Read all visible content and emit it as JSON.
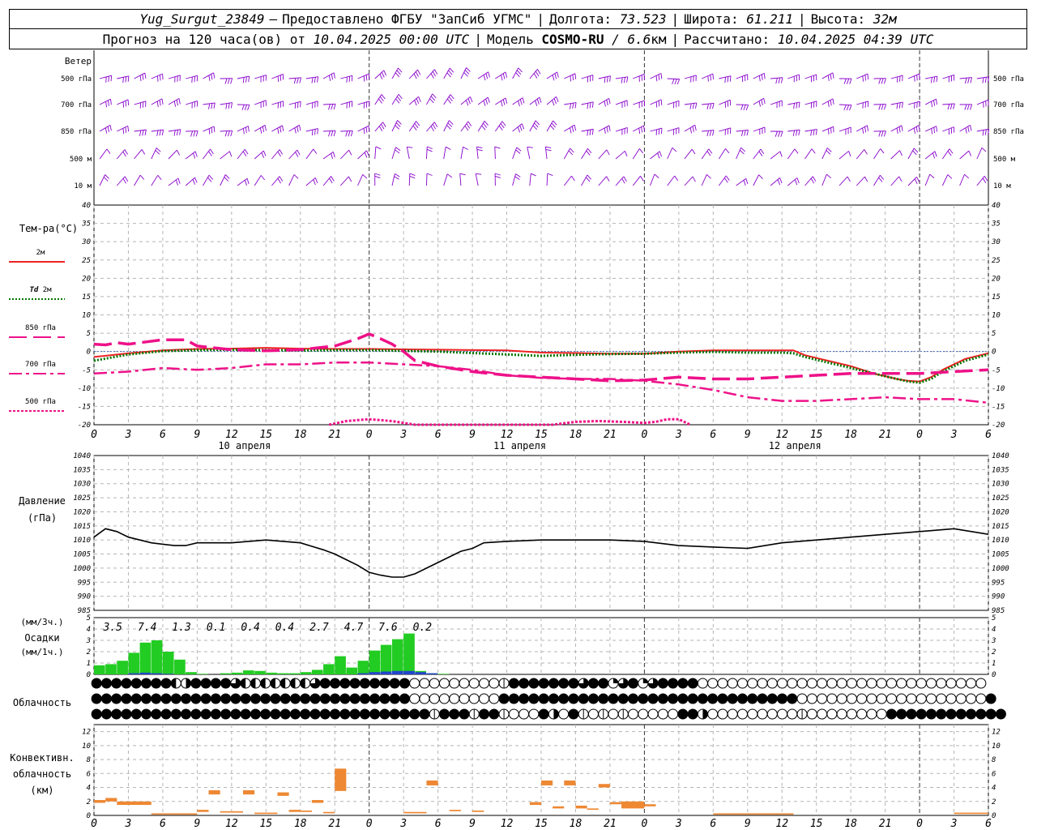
{
  "header": {
    "station": "Yug_Surgut_23849",
    "dash": "—",
    "provider": "Предоставлено ФГБУ \"ЗапСиб УГМС\"",
    "lon_label": "Долгота:",
    "lon_value": "73.523",
    "lat_label": "Широта:",
    "lat_value": "61.211",
    "alt_label": "Высота:",
    "alt_value": "32м",
    "forecast_prefix": "Прогноз на 120 часа(ов) от",
    "forecast_time": "10.04.2025 00:00 UTC",
    "model_label": "Модель",
    "model_name": "COSMO-RU",
    "model_res": "/ 6.6",
    "model_res_unit": "км",
    "calc_label": "Рассчитано:",
    "calc_time": "10.04.2025 04:39 UTC"
  },
  "labels": {
    "wind": "Ветер",
    "temp": "Тем-ра(°С)",
    "pressure1": "Давление",
    "pressure2": "(гПа)",
    "precip1": "(мм/3ч.)",
    "precip2": "Осадки",
    "precip3": "(мм/1ч.)",
    "cloud": "Облачность",
    "conv1": "Конвективн.",
    "conv2": "облачность",
    "conv3": "(км)"
  },
  "colors": {
    "t2m": "#ee2222",
    "td2m": "#007700",
    "t850": "#ee1188",
    "t700": "#ee1188",
    "t500": "#ee1188",
    "wind": "#8800cc",
    "precip3h": "#22cc22",
    "precip1h": "#2244cc",
    "convective": "#ee8833",
    "pressure": "#000000"
  },
  "chart_data": [
    {
      "type": "wind_barbs",
      "levels": [
        "500 гПа",
        "700 гПа",
        "850 гПа",
        "500 м",
        "10  м"
      ],
      "hours": [
        0,
        120
      ],
      "title": "Ветер"
    },
    {
      "type": "line",
      "title": "Тем-ра(°С)",
      "ylim": [
        -20,
        40
      ],
      "yticks": [
        40,
        35,
        30,
        25,
        20,
        15,
        10,
        5,
        0,
        -5,
        -10,
        -15,
        -20
      ],
      "x_hours": [
        0,
        3,
        6,
        9,
        12,
        15,
        18,
        21,
        24,
        27,
        30,
        33,
        36,
        39,
        42,
        45,
        48,
        51,
        54,
        57,
        60,
        63,
        66,
        69,
        72,
        75,
        78
      ],
      "x_tick_labels": [
        "0",
        "3",
        "6",
        "9",
        "12",
        "15",
        "18",
        "21",
        "0",
        "3",
        "6",
        "9",
        "12",
        "15",
        "18",
        "21",
        "0",
        "3",
        "6",
        "9",
        "12",
        "15",
        "18",
        "21",
        "0",
        "3",
        "6"
      ],
      "day_labels": [
        {
          "hour": 12,
          "text": "10 апреля"
        },
        {
          "hour": 36,
          "text": "11 апреля"
        },
        {
          "hour": 60,
          "text": "12 апреля"
        }
      ],
      "series": [
        {
          "name": "2м",
          "key": "t2m",
          "style": "solid",
          "x": [
            0,
            3,
            6,
            9,
            12,
            15,
            18,
            21,
            24,
            27,
            30,
            33,
            36,
            39,
            42,
            45,
            48,
            51,
            54,
            57,
            60,
            61,
            62,
            64,
            66,
            68,
            70,
            71,
            72,
            73,
            74,
            76,
            78
          ],
          "y": [
            -1.5,
            -0.5,
            0.3,
            0.7,
            0.8,
            1.0,
            0.8,
            0.7,
            0.7,
            0.6,
            0.5,
            0.4,
            0.3,
            -0.3,
            -0.4,
            -0.6,
            -0.6,
            0,
            0.3,
            0.3,
            0.3,
            0.3,
            -1,
            -2.5,
            -4,
            -6,
            -7.5,
            -8,
            -8.2,
            -7,
            -5,
            -2,
            -0.5
          ]
        },
        {
          "name": "Td 2м",
          "key": "td2m",
          "style": "dotted",
          "x": [
            0,
            3,
            6,
            9,
            12,
            15,
            18,
            21,
            24,
            27,
            30,
            33,
            36,
            39,
            42,
            45,
            48,
            51,
            54,
            57,
            60,
            61,
            62,
            64,
            66,
            68,
            70,
            71,
            72,
            73,
            74,
            76,
            78
          ],
          "y": [
            -2.5,
            -0.8,
            0.1,
            0.4,
            0.5,
            0.4,
            0.3,
            0.4,
            0.4,
            0.2,
            0,
            -0.4,
            -0.8,
            -1.2,
            -0.9,
            -0.7,
            -0.6,
            -0.3,
            -0.1,
            -0.3,
            -0.3,
            -0.5,
            -1.5,
            -3,
            -4.5,
            -6,
            -7.5,
            -8.2,
            -8.5,
            -7.5,
            -5.5,
            -2.5,
            -0.8
          ]
        },
        {
          "name": "850 гПа",
          "key": "t850",
          "style": "dash",
          "x": [
            0,
            1,
            2,
            3,
            6,
            8,
            9,
            12,
            15,
            18,
            21,
            23,
            24,
            25,
            26,
            27,
            28,
            30,
            33,
            36,
            39,
            42,
            45,
            48,
            51,
            54,
            57,
            60,
            63,
            66,
            69,
            72,
            75,
            78
          ],
          "y": [
            2,
            1.8,
            2.4,
            2,
            3.2,
            3.2,
            1.5,
            0.5,
            0.2,
            0.5,
            1.5,
            3.5,
            4.8,
            3.5,
            2,
            0,
            -2.5,
            -4,
            -5.5,
            -6.5,
            -7,
            -7.5,
            -8,
            -7.8,
            -7,
            -7.5,
            -7.5,
            -7,
            -6.5,
            -6,
            -6,
            -6,
            -5.5,
            -5
          ]
        },
        {
          "name": "700 гПа",
          "key": "t700",
          "style": "dashdot",
          "x": [
            0,
            3,
            6,
            9,
            12,
            15,
            18,
            21,
            24,
            27,
            30,
            33,
            36,
            39,
            42,
            45,
            48,
            51,
            54,
            57,
            60,
            63,
            66,
            69,
            72,
            75,
            78
          ],
          "y": [
            -6,
            -5.5,
            -4.5,
            -5,
            -4.5,
            -3.5,
            -3.5,
            -3,
            -3,
            -3.5,
            -4,
            -5,
            -6.5,
            -7.2,
            -7.5,
            -7.5,
            -8,
            -9,
            -10.5,
            -12.5,
            -13.5,
            -13.5,
            -13,
            -12.5,
            -13,
            -13,
            -14
          ]
        },
        {
          "name": "500 гПа",
          "key": "t500",
          "style": "dotted",
          "x": [
            20.5,
            22,
            24,
            26,
            28,
            40,
            42,
            44,
            46,
            48,
            49,
            50,
            51,
            52
          ],
          "y": [
            -20,
            -19,
            -18.5,
            -19,
            -20,
            -20,
            -19.2,
            -19,
            -19.2,
            -19.5,
            -19.2,
            -18.5,
            -18.5,
            -20
          ]
        }
      ]
    },
    {
      "type": "line",
      "title": "Давление (гПа)",
      "ylim": [
        985,
        1040
      ],
      "yticks": [
        1040,
        1035,
        1030,
        1025,
        1020,
        1015,
        1010,
        1005,
        1000,
        995,
        990,
        985
      ],
      "series": [
        {
          "name": "Давление",
          "key": "pressure",
          "x": [
            0,
            1,
            2,
            3,
            4,
            5,
            6,
            7,
            8,
            9,
            12,
            15,
            18,
            20,
            21,
            22,
            23,
            24,
            25,
            26,
            27,
            28,
            30,
            32,
            33,
            34,
            36,
            39,
            42,
            45,
            48,
            51,
            54,
            57,
            60,
            63,
            66,
            69,
            72,
            75,
            78
          ],
          "y": [
            1011,
            1014,
            1013,
            1011,
            1010,
            1009,
            1008.5,
            1008,
            1008,
            1009,
            1009,
            1010,
            1009,
            1006.5,
            1005,
            1003,
            1001,
            998.5,
            997.5,
            996.8,
            996.8,
            998,
            1002,
            1006,
            1007,
            1009,
            1009.5,
            1010,
            1010,
            1010,
            1009.5,
            1008,
            1007.5,
            1007,
            1009,
            1010,
            1011,
            1012,
            1013,
            1014,
            1012
          ]
        }
      ]
    },
    {
      "type": "bar",
      "title": "Осадки",
      "ylim": [
        0,
        5
      ],
      "yticks": [
        5,
        4,
        3,
        2,
        1,
        0
      ],
      "totals_3h": [
        {
          "hour": 1.5,
          "text": "3.5"
        },
        {
          "hour": 4.5,
          "text": "7.4"
        },
        {
          "hour": 7.5,
          "text": "1.3"
        },
        {
          "hour": 10.5,
          "text": "0.1"
        },
        {
          "hour": 13.5,
          "text": "0.4"
        },
        {
          "hour": 16.5,
          "text": "0.4"
        },
        {
          "hour": 19.5,
          "text": "2.7"
        },
        {
          "hour": 22.5,
          "text": "4.7"
        },
        {
          "hour": 25.5,
          "text": "7.6"
        },
        {
          "hour": 28.5,
          "text": "0.2"
        }
      ],
      "series": [
        {
          "name": "мм/1ч",
          "key": "precip3h",
          "values": [
            0.8,
            0.9,
            1.2,
            1.9,
            2.8,
            3.0,
            2.0,
            1.3,
            0.2,
            0.05,
            0,
            0.1,
            0.15,
            0.35,
            0.3,
            0.15,
            0.1,
            0.1,
            0.2,
            0.4,
            0.9,
            1.6,
            0.6,
            1.2,
            2.1,
            2.6,
            3.1,
            3.6,
            0.3,
            0.1,
            0.05
          ]
        },
        {
          "name": "мм/1ч",
          "key": "precip1h",
          "values": [
            0,
            0,
            0,
            0.1,
            0.15,
            0.1,
            0.05,
            0,
            0,
            0,
            0,
            0,
            0,
            0,
            0,
            0,
            0,
            0,
            0,
            0,
            0,
            0,
            0,
            0.1,
            0.2,
            0.25,
            0.3,
            0.3,
            0.2,
            0.1,
            0
          ]
        }
      ]
    },
    {
      "type": "cloud_symbols",
      "title": "Облачность",
      "rows": 3,
      "step_hours": 1,
      "rows_f": [
        "FFFFFFFFLHFFFFKLLLLLLLMFFFFFFFFFEEEEEEEEEJFFFFFFFKFFGKFGKFFFFEEEEEEEEEEEEEEEEEEEEEEEEEEEEE",
        "FFFFFFFFFFFFFFFFFFFFFFFFFFFFFFFFEEEEEEEEEFFFFFFFFFFFFFFFFFFFFFFFFFFFFFFEEEEEEEEEEEEEEEEEEEF",
        "FFFFFFFFFFFFFFFFFFFFFFFFFFFFFFFFFFJFFFJFFJEEEFHEFJEJEJEEEEEFFHEEEEEEEEEJEEEEEEEEFFFFFFFFFFFF"
      ]
    },
    {
      "type": "bar",
      "title": "Конвективн. облачность (км)",
      "ylim": [
        0,
        13
      ],
      "yticks": [
        12,
        10,
        8,
        6,
        4,
        2,
        0
      ],
      "segments": [
        [
          0,
          1,
          1.8,
          2.2
        ],
        [
          1,
          2,
          2.0,
          2.5
        ],
        [
          2,
          5,
          1.5,
          2.0
        ],
        [
          5,
          9,
          0.1,
          0.3
        ],
        [
          9,
          10,
          0.5,
          0.8
        ],
        [
          10,
          11,
          3.0,
          3.6
        ],
        [
          11,
          13,
          0.4,
          0.6
        ],
        [
          13,
          14,
          3.0,
          3.6
        ],
        [
          14,
          16,
          0.2,
          0.4
        ],
        [
          16,
          17,
          2.8,
          3.3
        ],
        [
          17,
          18,
          0.5,
          0.8
        ],
        [
          18,
          19,
          0.5,
          0.7
        ],
        [
          19,
          20,
          1.8,
          2.2
        ],
        [
          20,
          21,
          0.3,
          0.5
        ],
        [
          21,
          22,
          3.5,
          6.7
        ],
        [
          27,
          29,
          0.3,
          0.5
        ],
        [
          29,
          30,
          4.3,
          5.0
        ],
        [
          31,
          32,
          0.6,
          0.8
        ],
        [
          33,
          34,
          0.5,
          0.7
        ],
        [
          38,
          39,
          1.5,
          1.9
        ],
        [
          39,
          40,
          4.3,
          5.0
        ],
        [
          40,
          41,
          1.0,
          1.3
        ],
        [
          41,
          42,
          4.3,
          5.0
        ],
        [
          42,
          43,
          1.0,
          1.4
        ],
        [
          43,
          44,
          0.8,
          1.0
        ],
        [
          44,
          45,
          4.0,
          4.5
        ],
        [
          45,
          46,
          1.6,
          1.9
        ],
        [
          46,
          48,
          1.0,
          2.0
        ],
        [
          48,
          49,
          1.3,
          1.6
        ],
        [
          54,
          61,
          0.1,
          0.3
        ],
        [
          75,
          78,
          0.2,
          0.4
        ]
      ]
    }
  ]
}
